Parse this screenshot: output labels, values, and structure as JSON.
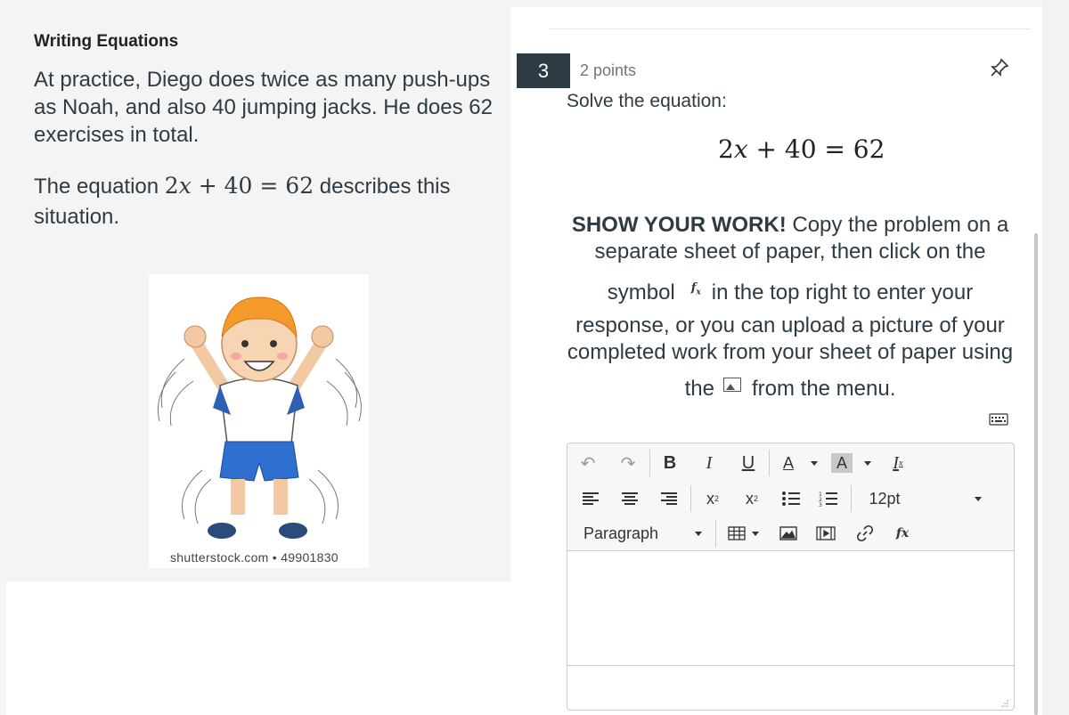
{
  "left_panel": {
    "title": "Writing Equations",
    "paragraph": "At practice, Diego does twice as many push-ups as Noah, and also 40 jumping jacks. He does 62 exercises in total.",
    "equation_prefix": "The equation ",
    "equation_suffix": " describes this situation.",
    "image_caption": "shutterstock.com • 49901830"
  },
  "question": {
    "number": "3",
    "points": "2 points",
    "prompt": "Solve the equation:",
    "instructions": {
      "emphasis": "SHOW YOUR WORK!",
      "line1_rest": " Copy the problem on a",
      "line2": "separate sheet of paper, then click on the",
      "line3_before": "symbol",
      "line3_after": "in the top right to enter your",
      "line4": "response, or you can upload a picture of your",
      "line5": "completed work from your sheet of paper using",
      "line6_before": "the",
      "line6_after": "from the menu."
    }
  },
  "editor": {
    "font_size_value": "12pt",
    "block_format_value": "Paragraph",
    "fx_label": "fx",
    "text_color_label": "A",
    "bg_color_label": "A"
  },
  "colors": {
    "question_number_bg": "#2d3b45",
    "text": "#2d3b45",
    "left_panel_bg": "#f4f4f5"
  }
}
